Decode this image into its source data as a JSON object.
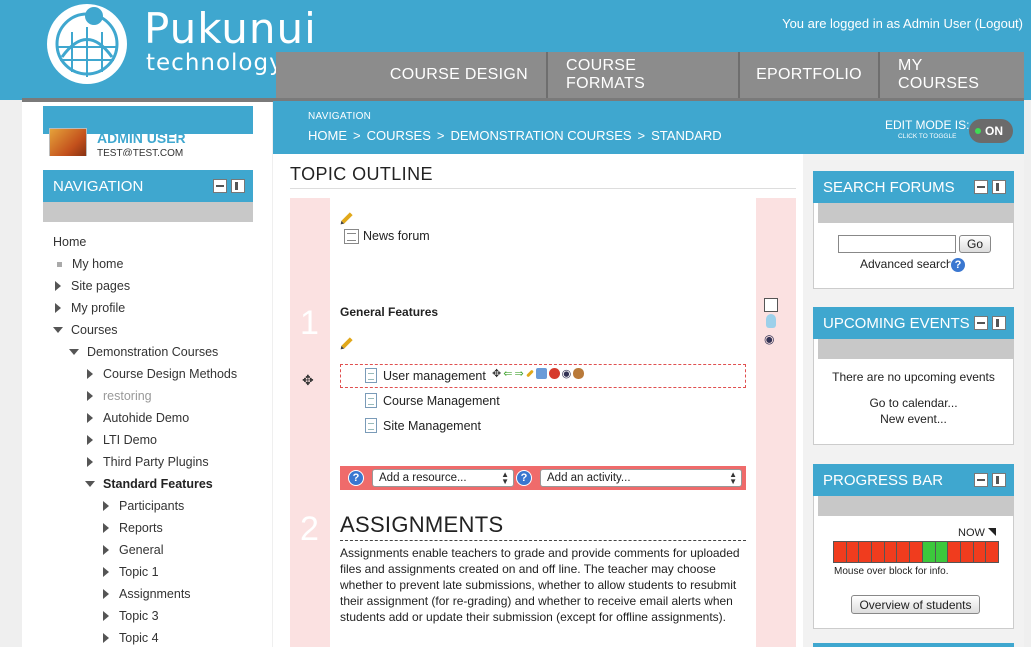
{
  "brand": {
    "name": "Pukunui",
    "tagline": "technology"
  },
  "header": {
    "logged_in": "You are logged in as Admin User (Logout)"
  },
  "topnav": [
    "COURSE DESIGN",
    "COURSE FORMATS",
    "EPORTFOLIO",
    "MY COURSES"
  ],
  "user": {
    "name": "ADMIN USER",
    "email": "TEST@TEST.COM"
  },
  "navigation_block": {
    "title": "NAVIGATION",
    "items": [
      {
        "label": "Home"
      },
      {
        "label": "My home"
      },
      {
        "label": "Site pages"
      },
      {
        "label": "My profile"
      },
      {
        "label": "Courses"
      },
      {
        "label": "Demonstration Courses"
      },
      {
        "label": "Course Design Methods"
      },
      {
        "label": "restoring"
      },
      {
        "label": "Autohide Demo"
      },
      {
        "label": "LTI Demo"
      },
      {
        "label": "Third Party Plugins"
      },
      {
        "label": "Standard Features"
      },
      {
        "label": "Participants"
      },
      {
        "label": "Reports"
      },
      {
        "label": "General"
      },
      {
        "label": "Topic 1"
      },
      {
        "label": "Assignments"
      },
      {
        "label": "Topic 3"
      },
      {
        "label": "Topic 4"
      }
    ]
  },
  "breadcrumb": {
    "label": "NAVIGATION",
    "items": [
      "HOME",
      ">",
      "COURSES",
      ">",
      "DEMONSTRATION COURSES",
      ">",
      "STANDARD"
    ]
  },
  "edit_mode": {
    "label": "EDIT MODE IS:",
    "hint": "CLICK TO TOGGLE",
    "state": "ON"
  },
  "main": {
    "title": "TOPIC OUTLINE",
    "section0": {
      "activity": "News forum"
    },
    "section1": {
      "number": "1",
      "title": "General Features",
      "activities": [
        "User management",
        "Course Management",
        "Site Management"
      ],
      "add_resource": "Add a resource...",
      "add_activity": "Add an activity..."
    },
    "section2": {
      "number": "2",
      "title": "ASSIGNMENTS",
      "summary": "Assignments enable teachers to grade and provide comments for uploaded files and assignments created on and off line. The teacher may choose whether to prevent late submissions, whether to allow students to resubmit their assignment (for re-grading) and whether to receive email alerts when students add or update their submission (except for offline assignments)."
    }
  },
  "search_forums": {
    "title": "SEARCH FORUMS",
    "button": "Go",
    "advanced": "Advanced search"
  },
  "upcoming_events": {
    "title": "UPCOMING EVENTS",
    "empty": "There are no upcoming events",
    "calendar_link": "Go to calendar...",
    "new_event": "New event..."
  },
  "progress_bar": {
    "title": "PROGRESS BAR",
    "now_label": "NOW",
    "hint": "Mouse over block for info.",
    "button": "Overview of students",
    "cells": [
      "red",
      "red",
      "red",
      "red",
      "red",
      "red",
      "red",
      "green",
      "green",
      "red",
      "red",
      "red",
      "red"
    ]
  },
  "colors": {
    "accent": "#3fa7cf",
    "section_bg": "#fbe1e1",
    "red": "#f03c1e",
    "green": "#3cc83c"
  }
}
